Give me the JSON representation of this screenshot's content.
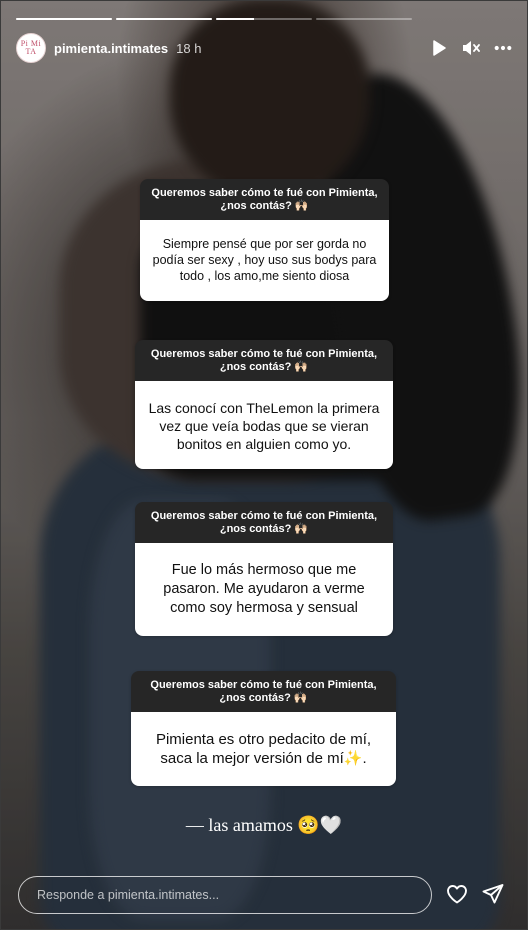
{
  "story": {
    "segments": [
      1,
      1,
      0.4,
      0
    ],
    "username": "pimienta.intimates",
    "time_ago": "18 h",
    "avatar_text": "PiMi TA"
  },
  "header_icons": [
    "play-icon",
    "mute-icon",
    "more-icon"
  ],
  "question": "Queremos saber cómo te fué con Pimienta, ¿nos contás? 🙌🏻",
  "cards": [
    {
      "question": "Queremos saber cómo te fué con Pimienta, ¿nos contás? 🙌🏻",
      "answer": "Siempre pensé que por ser gorda no podía ser sexy , hoy uso sus bodys para todo , los amo,me siento diosa"
    },
    {
      "question": "Queremos saber cómo te fué con Pimienta, ¿nos contás? 🙌🏻",
      "answer": "Las conocí con TheLemon la primera vez que veía bodas que se vieran bonitos en alguien como yo."
    },
    {
      "question": "Queremos saber cómo te fué con Pimienta, ¿nos contás? 🙌🏻",
      "answer": "Fue lo más hermoso que me pasaron. Me ayudaron a verme como soy hermosa y sensual"
    },
    {
      "question": "Queremos saber cómo te fué con Pimienta, ¿nos contás? 🙌🏻",
      "answer": "Pimienta es otro pedacito de mí, saca la mejor versión de mí✨."
    }
  ],
  "closing_text": "— las amamos 🥺🤍",
  "reply": {
    "placeholder": "Responde a pimienta.intimates..."
  },
  "colors": {
    "card_header": "#262626",
    "card_body": "#ffffff",
    "accent": "#ffffff"
  }
}
